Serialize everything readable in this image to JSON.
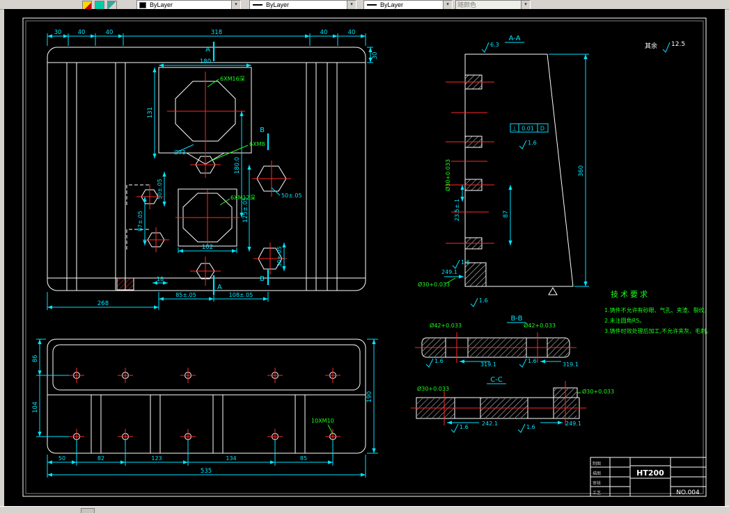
{
  "toolbar": {
    "color_control": "ByLayer",
    "linetype_control": "ByLayer",
    "lineweight_control": "ByLayer",
    "plotstyle_control": "随颜色"
  },
  "icons": {
    "dropdown_arrow": "▾"
  },
  "plan": {
    "dims_top": [
      "30",
      "40",
      "40",
      "318",
      "40",
      "40"
    ],
    "dim_right30": "30",
    "dim_180": "180",
    "thread_6xm16": "6XM16深",
    "sec_a": "A",
    "sec_b": "B",
    "dim_131": "131",
    "thread_6xm8": "6XM8",
    "dia_73": "Ø73",
    "dim_180_0": "180.0",
    "dim_50_right": "50±.05",
    "thread_6xm12": "6XM12深",
    "dim_50_left": "50±.05",
    "dim_87_left": "87±.05",
    "dim_125": "125±.05",
    "dim_102": "102",
    "dim_30_right": "30±.05",
    "dim_18": "18",
    "dim_85": "85±.05",
    "dim_108": "108±.05",
    "dim_268": "268"
  },
  "side": {
    "dim_86": "86",
    "dim_104": "104",
    "dim_190": "190",
    "dims_bottom": [
      "50",
      "82",
      "123",
      "134",
      "85"
    ],
    "dim_535": "535",
    "thread_10xm10": "10XM10"
  },
  "sec_aa": {
    "title": "A-A",
    "finish_top": "6.3",
    "fcf_sym": "⊥",
    "fcf_tol": "0.01",
    "fcf_datum": "D",
    "finish_16_a": "1.6",
    "finish_16_b": "1.6",
    "finish_16_c": "1.6",
    "dia30_side": "Ø30+0.033",
    "dim_235": "23.5±.1",
    "dim_87": "87",
    "dim_360": "360",
    "dim_2491": "249.1",
    "dia30_bottom": "Ø30+0.033"
  },
  "general_finish": {
    "label": "其余",
    "value": "12.5"
  },
  "sec_bb": {
    "title": "B-B",
    "dia_left": "Ø42+0.033",
    "dia_right": "Ø42+0.033",
    "dim_left": "319.1",
    "dim_right": "319.1",
    "finish_left": "1.6",
    "finish_right": "1.6"
  },
  "sec_cc": {
    "title": "C-C",
    "dia_left": "Ø30+0.033",
    "dia_right": "Ø30+0.033",
    "dim_left": "242.1",
    "dim_right": "249.1",
    "finish_left": "1.6",
    "finish_right": "1.6"
  },
  "notes": {
    "title": "技术要求",
    "items": [
      "1.铸件不允许有砂眼、气孔、夹渣、裂纹。",
      "2.未注圆角R5。",
      "3.铸件时效处理后加工,不允许夹灰、毛刺。"
    ]
  },
  "title_block": {
    "material": "HT200",
    "drawing_no": "NO.004",
    "rows": [
      "制图",
      "描图",
      "审核",
      "工艺"
    ]
  },
  "colors": {
    "background": "#000000",
    "geometry": "#ffffff",
    "dimension": "#00e5ff",
    "centerline": "#ff2a2a",
    "annotation": "#19ff19",
    "toolbar": "#d6d3ce"
  }
}
